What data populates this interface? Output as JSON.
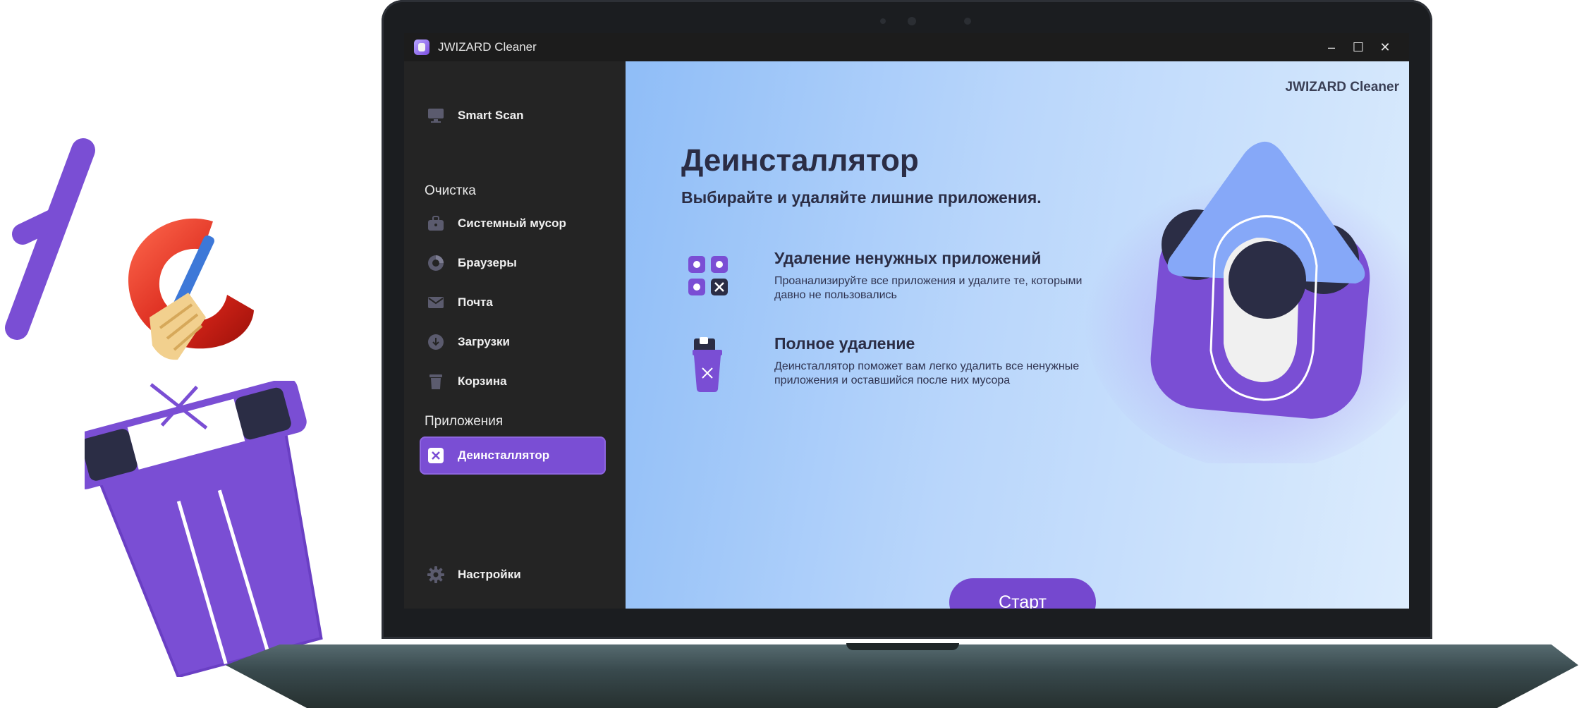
{
  "window": {
    "title": "JWIZARD Cleaner",
    "controls": {
      "minimize": "–",
      "maximize": "☐",
      "close": "✕"
    }
  },
  "sidebar": {
    "smart_scan": "Smart Scan",
    "section_cleaning": "Очистка",
    "cleaning_items": [
      {
        "label": "Системный мусор",
        "icon": "briefcase-icon"
      },
      {
        "label": "Браузеры",
        "icon": "browser-icon"
      },
      {
        "label": "Почта",
        "icon": "mail-icon"
      },
      {
        "label": "Загрузки",
        "icon": "download-icon"
      },
      {
        "label": "Корзина",
        "icon": "trash-icon"
      }
    ],
    "section_apps": "Приложения",
    "apps_items": [
      {
        "label": "Деинсталлятор",
        "icon": "uninstall-icon",
        "active": true
      }
    ],
    "settings": "Настройки"
  },
  "content": {
    "brand": "JWIZARD Cleaner",
    "heading": "Деинсталлятор",
    "subheading": "Выбирайте и удаляйте лишние приложения.",
    "features": [
      {
        "title": "Удаление ненужных приложений",
        "description": "Проанализируйте все приложения и удалите те, которыми давно не пользовались",
        "icon": "apps-grid-icon"
      },
      {
        "title": "Полное удаление",
        "description": "Деинсталлятор поможет вам легко удалить все ненужные приложения и оставшийся после них мусора",
        "icon": "bin-icon"
      }
    ],
    "start_button": "Старт"
  },
  "colors": {
    "accent": "#7a4ed4",
    "button": "#7548cf",
    "sidebar_bg": "#242424",
    "heading_text": "#2b2d45"
  }
}
